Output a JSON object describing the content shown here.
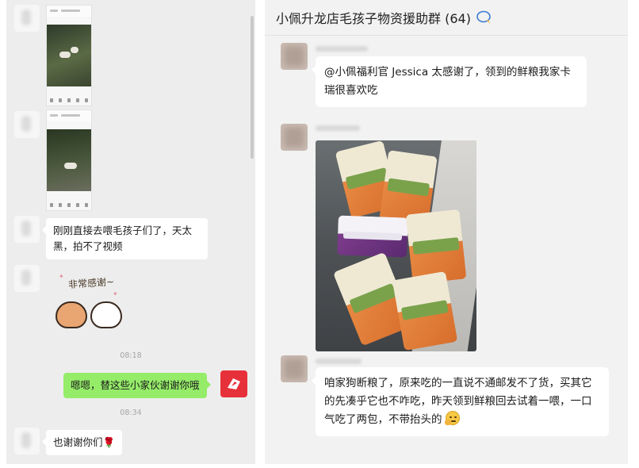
{
  "left_chat": {
    "messages": [
      {
        "type": "image",
        "sender": "contact"
      },
      {
        "type": "image",
        "sender": "contact"
      },
      {
        "type": "text",
        "sender": "contact",
        "text": "刚刚直接去喂毛孩子们了，天太黑，拍不了视频"
      },
      {
        "type": "sticker",
        "sender": "contact",
        "sticker_text": "非常感谢~"
      },
      {
        "type": "time",
        "text": "08:18"
      },
      {
        "type": "text",
        "sender": "self",
        "text": "嗯嗯，替这些小家伙谢谢你哦"
      },
      {
        "type": "time",
        "text": "08:34"
      },
      {
        "type": "text",
        "sender": "contact",
        "text": "也谢谢你们",
        "emoji": "🌹"
      }
    ],
    "colors": {
      "background": "#ededed",
      "outgoing_bubble": "#95ec69",
      "incoming_bubble": "#ffffff",
      "self_avatar": "#e6313a"
    }
  },
  "right_chat": {
    "group_title": "小佩升龙店毛孩子物资援助群 (64)",
    "messages": [
      {
        "type": "text",
        "sender": "group-member",
        "text": "@小佩福利官 Jessica 太感谢了，领到的鲜粮我家卡瑞很喜欢吃"
      },
      {
        "type": "image",
        "sender": "group-member",
        "content": "dog food packages"
      },
      {
        "type": "text",
        "sender": "group-member",
        "text": "咱家狗断粮了，原来吃的一直说不通邮发不了货，买其它的先凑乎它也不咋吃，昨天领到鲜粮回去试着一喂，一口气吃了两包，不带抬头的",
        "emoji": "thinking-face"
      }
    ],
    "colors": {
      "background": "#f2f2f2",
      "bubble": "#ffffff",
      "accent": "#576b95"
    }
  }
}
